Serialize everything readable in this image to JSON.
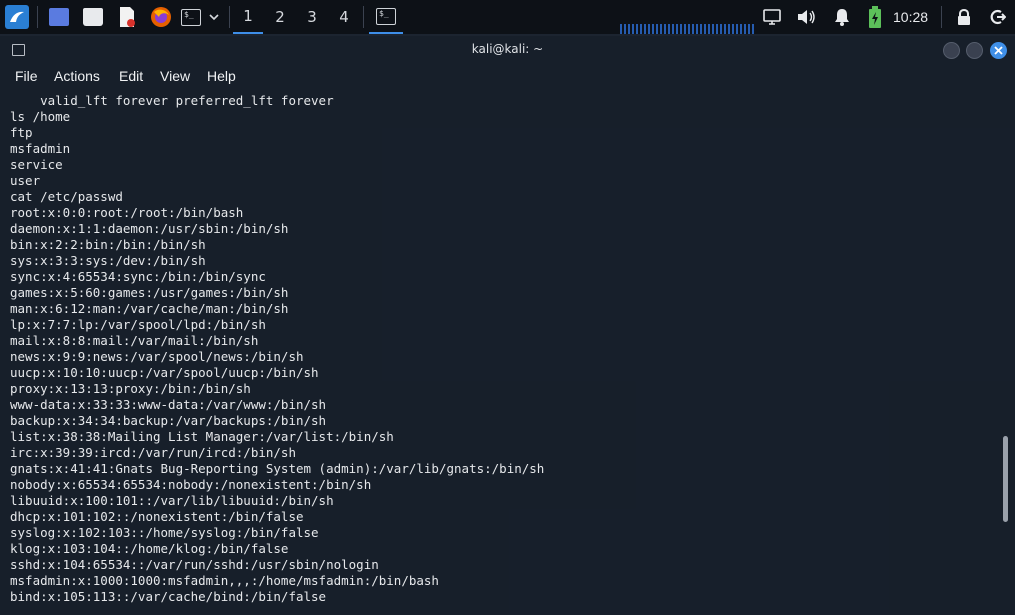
{
  "panel": {
    "workspaces": [
      "1",
      "2",
      "3",
      "4"
    ],
    "active_workspace": "1",
    "clock": "10:28",
    "accent_color": "#3e8ee8"
  },
  "window": {
    "title": "kali@kali: ~",
    "menu": [
      "File",
      "Actions",
      "Edit",
      "View",
      "Help"
    ]
  },
  "terminal": {
    "lines": [
      "    valid_lft forever preferred_lft forever",
      "ls /home",
      "ftp",
      "msfadmin",
      "service",
      "user",
      "cat /etc/passwd",
      "root:x:0:0:root:/root:/bin/bash",
      "daemon:x:1:1:daemon:/usr/sbin:/bin/sh",
      "bin:x:2:2:bin:/bin:/bin/sh",
      "sys:x:3:3:sys:/dev:/bin/sh",
      "sync:x:4:65534:sync:/bin:/bin/sync",
      "games:x:5:60:games:/usr/games:/bin/sh",
      "man:x:6:12:man:/var/cache/man:/bin/sh",
      "lp:x:7:7:lp:/var/spool/lpd:/bin/sh",
      "mail:x:8:8:mail:/var/mail:/bin/sh",
      "news:x:9:9:news:/var/spool/news:/bin/sh",
      "uucp:x:10:10:uucp:/var/spool/uucp:/bin/sh",
      "proxy:x:13:13:proxy:/bin:/bin/sh",
      "www-data:x:33:33:www-data:/var/www:/bin/sh",
      "backup:x:34:34:backup:/var/backups:/bin/sh",
      "list:x:38:38:Mailing List Manager:/var/list:/bin/sh",
      "irc:x:39:39:ircd:/var/run/ircd:/bin/sh",
      "gnats:x:41:41:Gnats Bug-Reporting System (admin):/var/lib/gnats:/bin/sh",
      "nobody:x:65534:65534:nobody:/nonexistent:/bin/sh",
      "libuuid:x:100:101::/var/lib/libuuid:/bin/sh",
      "dhcp:x:101:102::/nonexistent:/bin/false",
      "syslog:x:102:103::/home/syslog:/bin/false",
      "klog:x:103:104::/home/klog:/bin/false",
      "sshd:x:104:65534::/var/run/sshd:/usr/sbin/nologin",
      "msfadmin:x:1000:1000:msfadmin,,,:/home/msfadmin:/bin/bash",
      "bind:x:105:113::/var/cache/bind:/bin/false"
    ]
  }
}
